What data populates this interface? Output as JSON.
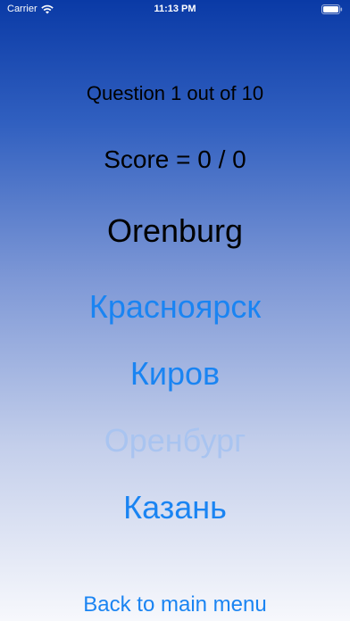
{
  "status_bar": {
    "carrier": "Carrier",
    "time": "11:13 PM",
    "wifi_icon": "wifi-icon",
    "battery_icon": "battery-icon"
  },
  "quiz": {
    "question_label": "Question 1 out of 10",
    "score_label": "Score = 0 / 0",
    "city": "Orenburg",
    "answers": [
      {
        "label": "Красноярск",
        "state": "normal"
      },
      {
        "label": "Киров",
        "state": "normal"
      },
      {
        "label": "Оренбург",
        "state": "dimmed"
      },
      {
        "label": "Казань",
        "state": "normal"
      }
    ],
    "back_label": "Back to main menu"
  },
  "colors": {
    "accent": "#1a84f2",
    "dimmed_accent": "#a9c4f0",
    "gradient_top": "#0a3aa6",
    "gradient_bottom": "#f7f8fc"
  }
}
